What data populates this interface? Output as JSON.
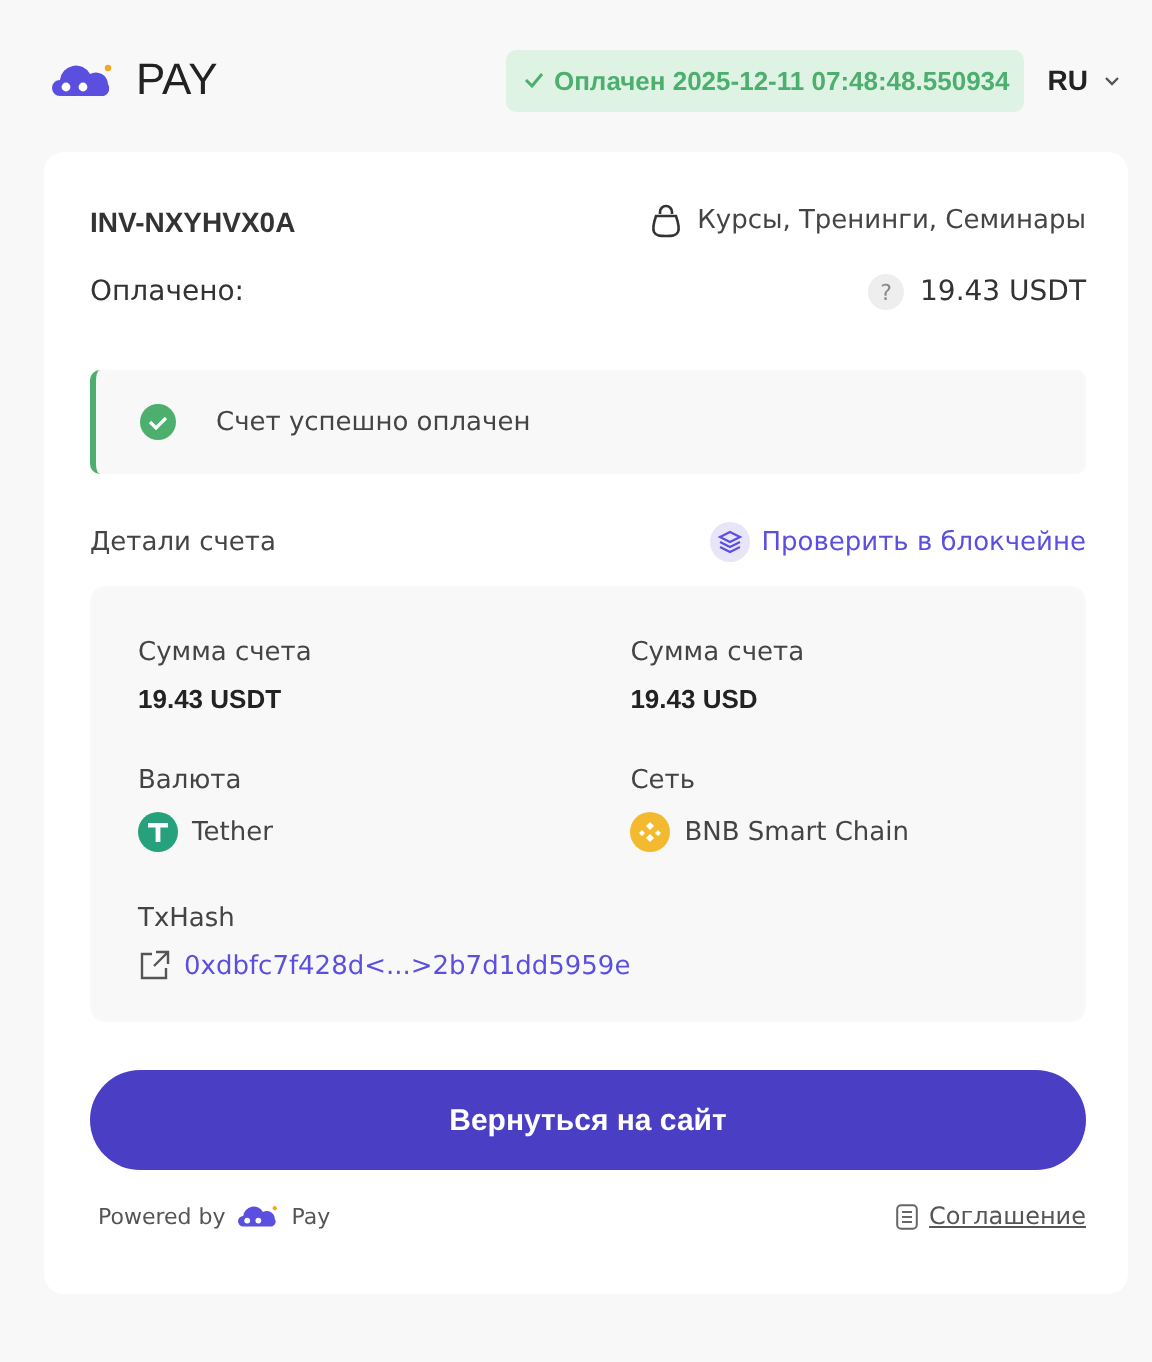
{
  "header": {
    "logo_text": "PAY",
    "status": "Оплачен 2025-12-11 07:48:48.550934",
    "language": "RU"
  },
  "invoice": {
    "id": "INV-NXYHVX0A",
    "category": "Курсы, Тренинги, Семинары",
    "paid_label": "Оплачено:",
    "help": "?",
    "paid_amount": "19.43 USDT"
  },
  "alert": {
    "text": "Счет успешно оплачен"
  },
  "details_title": "Детали счета",
  "blockchain_link": "Проверить в блокчейне",
  "details": [
    {
      "kind": "amount",
      "label": "Сумма счета",
      "value": "19.43 USDT"
    },
    {
      "kind": "amount",
      "label": "Сумма счета",
      "value": "19.43 USD"
    },
    {
      "kind": "currency",
      "label": "Валюта",
      "value": "Tether"
    },
    {
      "kind": "network",
      "label": "Сеть",
      "value": "BNB Smart Chain"
    },
    {
      "kind": "hash",
      "label": "TxHash",
      "value": "0xdbfc7f428d<...>2b7d1dd5959e"
    }
  ],
  "return_button": "Вернуться на сайт",
  "footer": {
    "powered_by": "Powered by",
    "brand": "Pay",
    "agreement": "Соглашение"
  }
}
